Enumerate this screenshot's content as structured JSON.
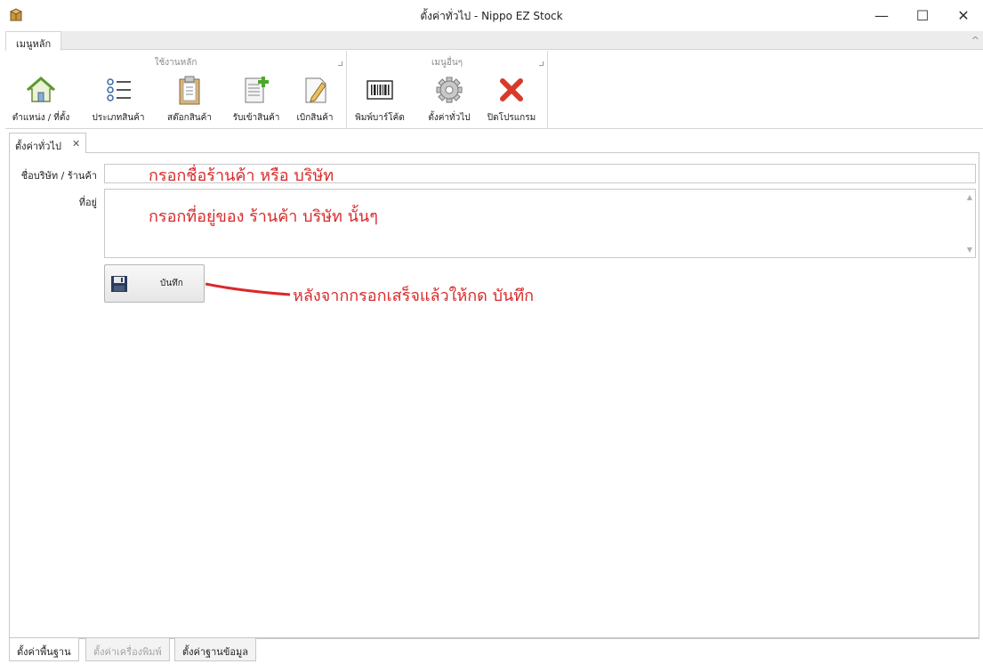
{
  "window": {
    "title": "ตั้งค่าทั่วไป - Nippo EZ Stock",
    "minimize_glyph": "—",
    "maximize_glyph": "☐",
    "close_glyph": "✕"
  },
  "ribbon": {
    "tab": "เมนูหลัก",
    "collapse_glyph": "^",
    "groups": [
      {
        "title": "ใช้งานหลัก",
        "buttons": [
          {
            "label": "ตำแหน่ง / ที่ตั้ง",
            "icon": "house-icon"
          },
          {
            "label": "ประเภทสินค้า",
            "icon": "list-icon"
          },
          {
            "label": "สต๊อกสินค้า",
            "icon": "clipboard-icon"
          },
          {
            "label": "รับเข้าสินค้า",
            "icon": "document-add-icon"
          },
          {
            "label": "เบิกสินค้า",
            "icon": "document-edit-icon"
          }
        ]
      },
      {
        "title": "เมนูอื่นๆ",
        "buttons": [
          {
            "label": "พิมพ์บาร์โค้ด",
            "icon": "barcode-icon"
          },
          {
            "label": "ตั้งค่าทั่วไป",
            "icon": "gear-icon"
          },
          {
            "label": "ปิดโปรแกรม",
            "icon": "close-x-icon"
          }
        ]
      }
    ]
  },
  "doc_tab": {
    "label": "ตั้งค่าทั่วไป",
    "close_glyph": "✕"
  },
  "form": {
    "company_label": "ชื่อบริษัท / ร้านค้า",
    "company_value": "",
    "address_label": "ที่อยู่",
    "address_value": "",
    "save_label": "บันทึก"
  },
  "annotations": {
    "company_hint": "กรอกชื่อร้านค้า หรือ บริษัท",
    "address_hint": "กรอกที่อยู่ของ ร้านค้า บริษัท นั้นๆ",
    "save_hint": "หลังจากกรอกเสร็จแล้วให้กด บันทึก",
    "color": "#d92a2a"
  },
  "bottom_tabs": [
    {
      "label": "ตั้งค่าพื้นฐาน",
      "state": "active"
    },
    {
      "label": "ตั้งค่าเครื่องพิมพ์",
      "state": "disabled"
    },
    {
      "label": "ตั้งค่าฐานข้อมูล",
      "state": "normal"
    }
  ]
}
